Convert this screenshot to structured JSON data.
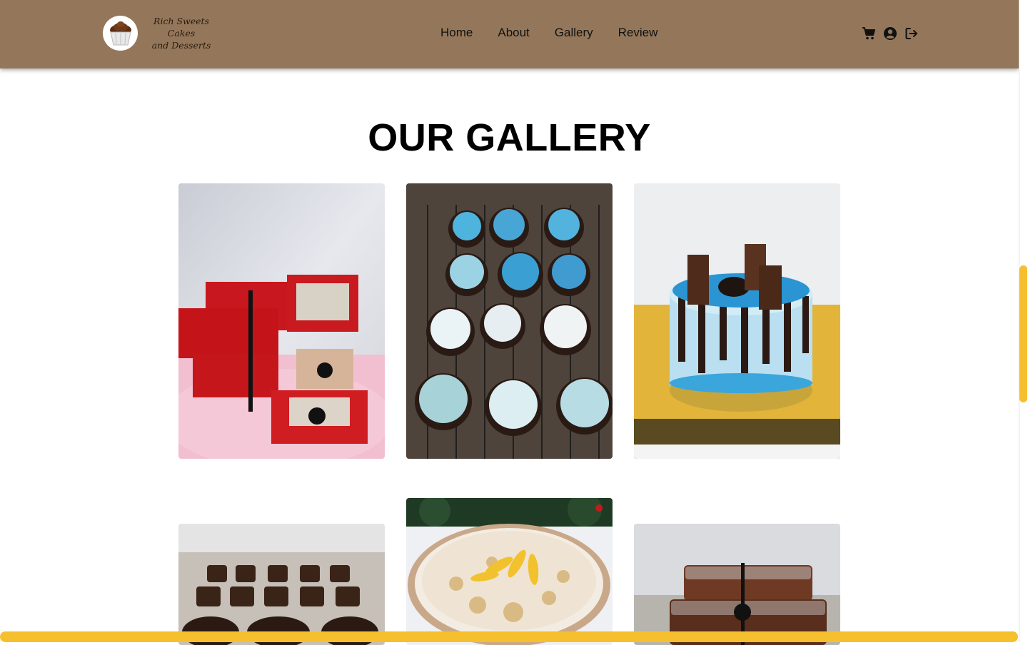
{
  "brand": {
    "name": "Rich Sweets Cakes and Desserts",
    "line1": "Rich Sweets Cakes",
    "line2": "and Desserts"
  },
  "nav": {
    "items": [
      {
        "label": "Home"
      },
      {
        "label": "About"
      },
      {
        "label": "Gallery"
      },
      {
        "label": "Review"
      }
    ],
    "icons": [
      "cart-icon",
      "user-circle-icon",
      "logout-icon"
    ]
  },
  "gallery": {
    "title": "OUR GALLERY",
    "photos": [
      {
        "alt": "red christmas dessert boxes"
      },
      {
        "alt": "blue and white frosted cupcakes on cooling rack"
      },
      {
        "alt": "blue drip cake with chocolate pieces"
      },
      {
        "alt": "chocolate dessert cups"
      },
      {
        "alt": "mango graham dessert"
      },
      {
        "alt": "packaged loaf cakes"
      }
    ]
  },
  "colors": {
    "navbar": "#94775a",
    "accent": "#f6bf2d"
  }
}
